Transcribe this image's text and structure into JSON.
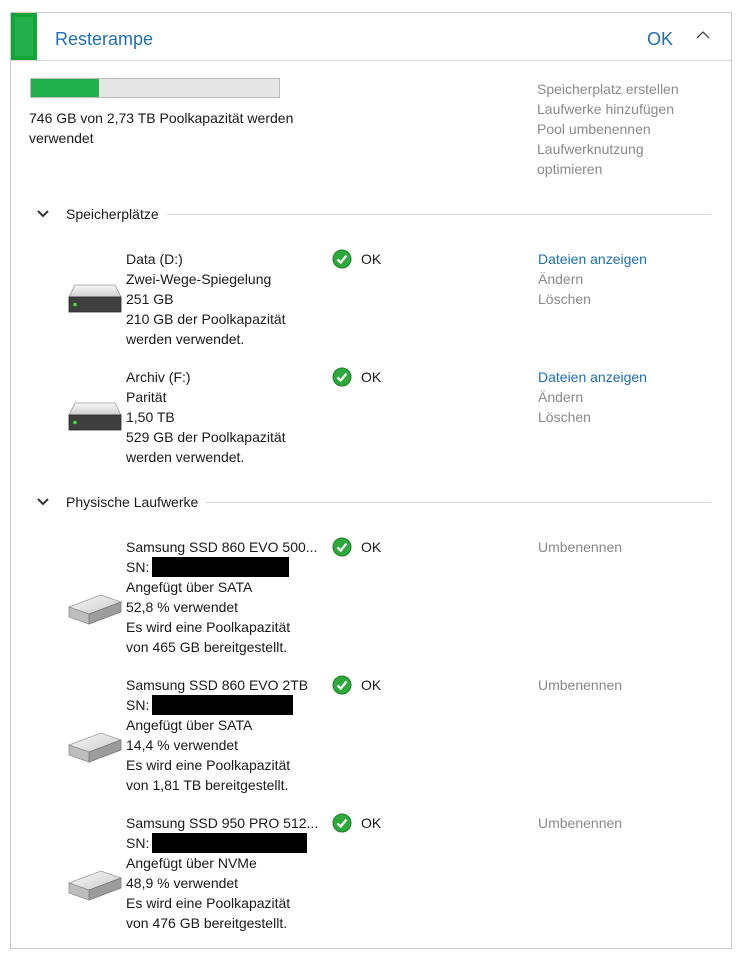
{
  "pool": {
    "title": "Resterampe",
    "status": "OK",
    "usage_fraction": 0.273,
    "usage_text": "746 GB von 2,73 TB Poolkapazität werden verwendet",
    "colors": {
      "accent": "#1e6fb5",
      "status_ok": "#22b14c"
    }
  },
  "pool_actions": [
    "Speicherplatz erstellen",
    "Laufwerke hinzufügen",
    "Pool umbenennen",
    "Laufwerknutzung optimieren"
  ],
  "sections": {
    "spaces_label": "Speicherplätze",
    "drives_label": "Physische Laufwerke"
  },
  "spaces": [
    {
      "name": "Data (D:)",
      "resiliency": "Zwei-Wege-Spiegelung",
      "size": "251 GB",
      "used_line1": "210 GB der Poolkapazität",
      "used_line2": "werden verwendet.",
      "status": "OK",
      "actions": {
        "view": "Dateien anzeigen",
        "change": "Ändern",
        "delete": "Löschen"
      }
    },
    {
      "name": "Archiv (F:)",
      "resiliency": "Parität",
      "size": "1,50 TB",
      "used_line1": "529 GB der Poolkapazität",
      "used_line2": "werden verwendet.",
      "status": "OK",
      "actions": {
        "view": "Dateien anzeigen",
        "change": "Ändern",
        "delete": "Löschen"
      }
    }
  ],
  "drives": [
    {
      "name": "Samsung SSD 860 EVO 500...",
      "sn_label": "SN:",
      "connection": "Angefügt über SATA",
      "used": "52,8 % verwendet",
      "cap_line1": "Es wird eine Poolkapazität",
      "cap_line2": "von 465 GB bereitgestellt.",
      "status": "OK",
      "action": "Umbenennen"
    },
    {
      "name": "Samsung SSD 860 EVO 2TB",
      "sn_label": "SN:",
      "connection": "Angefügt über SATA",
      "used": "14,4 % verwendet",
      "cap_line1": "Es wird eine Poolkapazität",
      "cap_line2": "von 1,81 TB bereitgestellt.",
      "status": "OK",
      "action": "Umbenennen"
    },
    {
      "name": "Samsung SSD 950 PRO 512...",
      "sn_label": "SN:",
      "connection": "Angefügt über NVMe",
      "used": "48,9 % verwendet",
      "cap_line1": "Es wird eine Poolkapazität",
      "cap_line2": "von 476 GB bereitgestellt.",
      "status": "OK",
      "action": "Umbenennen"
    }
  ],
  "icons": {
    "collapse": "chevron-up-icon",
    "section": "chevron-down-icon",
    "status": "check-circle-icon",
    "storage_space": "hard-drive-icon",
    "physical_drive": "ssd-icon"
  }
}
